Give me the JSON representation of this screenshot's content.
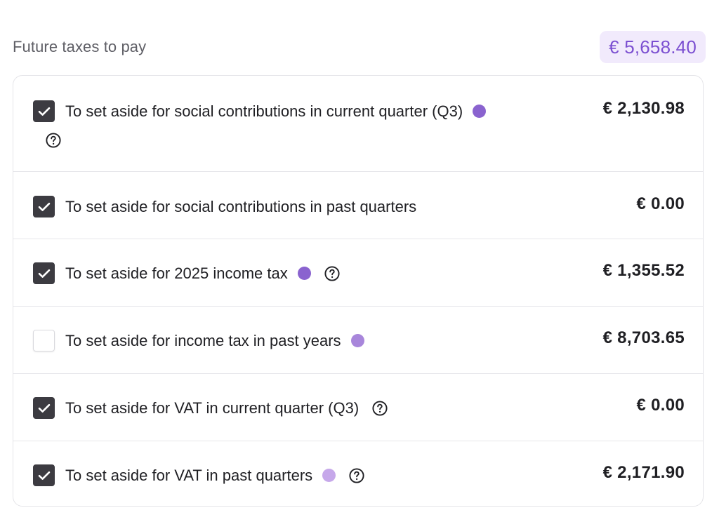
{
  "header": {
    "title": "Future taxes to pay",
    "total": "€ 5,658.40"
  },
  "colors": {
    "accent_text": "#7b4fd1",
    "accent_bg": "#f1eafc",
    "dot_dark": "#8a63cf",
    "dot_mid": "#a886db",
    "dot_light": "#c6a8ea",
    "checkbox_fill": "#3c3b41"
  },
  "items": [
    {
      "label": "To set aside for social contributions in current quarter (Q3)",
      "amount": "€ 2,130.98",
      "checked": true,
      "dot": "dot_dark",
      "help": true
    },
    {
      "label": "To set aside for social contributions in past quarters",
      "amount": "€ 0.00",
      "checked": true,
      "dot": null,
      "help": false
    },
    {
      "label": "To set aside for 2025 income tax",
      "amount": "€ 1,355.52",
      "checked": true,
      "dot": "dot_dark",
      "help": true
    },
    {
      "label": "To set aside for income tax in past years",
      "amount": "€ 8,703.65",
      "checked": false,
      "dot": "dot_mid",
      "help": false
    },
    {
      "label": "To set aside for VAT in current quarter (Q3)",
      "amount": "€ 0.00",
      "checked": true,
      "dot": null,
      "help": true
    },
    {
      "label": "To set aside for VAT in past quarters",
      "amount": "€ 2,171.90",
      "checked": true,
      "dot": "dot_light",
      "help": true
    }
  ],
  "icons": {
    "check": "checkmark-icon",
    "help": "question-circle-icon"
  }
}
